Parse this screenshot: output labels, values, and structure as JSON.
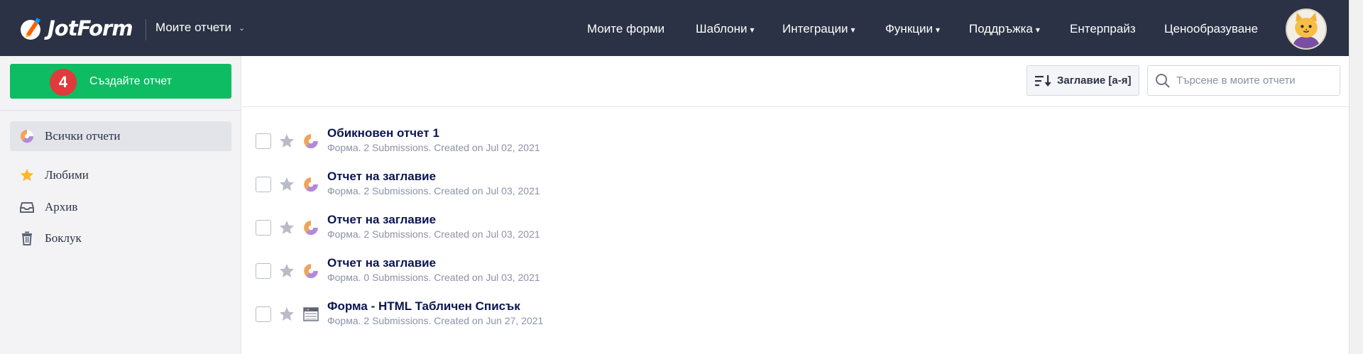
{
  "header": {
    "logo_text": "JotForm",
    "my_reports": "Моите отчети",
    "nav": [
      {
        "label": "Моите форми",
        "caret": false
      },
      {
        "label": "Шаблони",
        "caret": true
      },
      {
        "label": "Интеграции",
        "caret": true
      },
      {
        "label": "Функции",
        "caret": true
      },
      {
        "label": "Поддръжка",
        "caret": true
      },
      {
        "label": "Ентерпрайз",
        "caret": false
      },
      {
        "label": "Ценообразуване",
        "caret": false
      }
    ],
    "caret_glyph": "▾"
  },
  "sidebar": {
    "create_label": "Създайте отчет",
    "badge": "4",
    "items": [
      {
        "label": "Всички отчети",
        "icon": "report-icon",
        "active": true
      },
      {
        "label": "Любими",
        "icon": "star-icon",
        "active": false
      },
      {
        "label": "Архив",
        "icon": "archive-icon",
        "active": false
      },
      {
        "label": "Боклук",
        "icon": "trash-icon",
        "active": false
      }
    ]
  },
  "toolbar": {
    "sort_label": "Заглавие [а-я]",
    "search_placeholder": "Търсене в моите отчети"
  },
  "reports": [
    {
      "title": "Обикновен отчет 1",
      "meta": "Форма. 2 Submissions. Created on Jul 02, 2021",
      "icon": "report-icon"
    },
    {
      "title": "Отчет на заглавие",
      "meta": "Форма. 2 Submissions. Created on Jul 03, 2021",
      "icon": "report-icon"
    },
    {
      "title": "Отчет на заглавие",
      "meta": "Форма. 2 Submissions. Created on Jul 03, 2021",
      "icon": "report-icon"
    },
    {
      "title": "Отчет на заглавие",
      "meta": "Форма. 0 Submissions. Created on Jul 03, 2021",
      "icon": "report-icon"
    },
    {
      "title": "Форма - HTML Табличен Списък",
      "meta": "Форма. 2 Submissions. Created on Jun 27, 2021",
      "icon": "table-list-icon"
    }
  ],
  "colors": {
    "topbar": "#2b3245",
    "create_button": "#0dbc63",
    "badge": "#e03a3a",
    "title_text": "#0a1551",
    "meta_text": "#8d92a6"
  }
}
